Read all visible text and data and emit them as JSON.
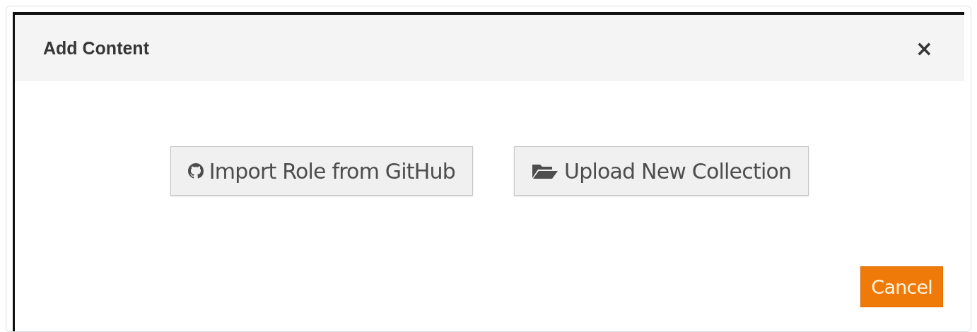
{
  "dialog": {
    "title": "Add Content",
    "close": "×"
  },
  "actions": [
    {
      "kind": "github",
      "label": "Import Role from GitHub"
    },
    {
      "kind": "folder",
      "label": "Upload New Collection"
    }
  ],
  "footer_buttons": [
    "Cancel"
  ]
}
